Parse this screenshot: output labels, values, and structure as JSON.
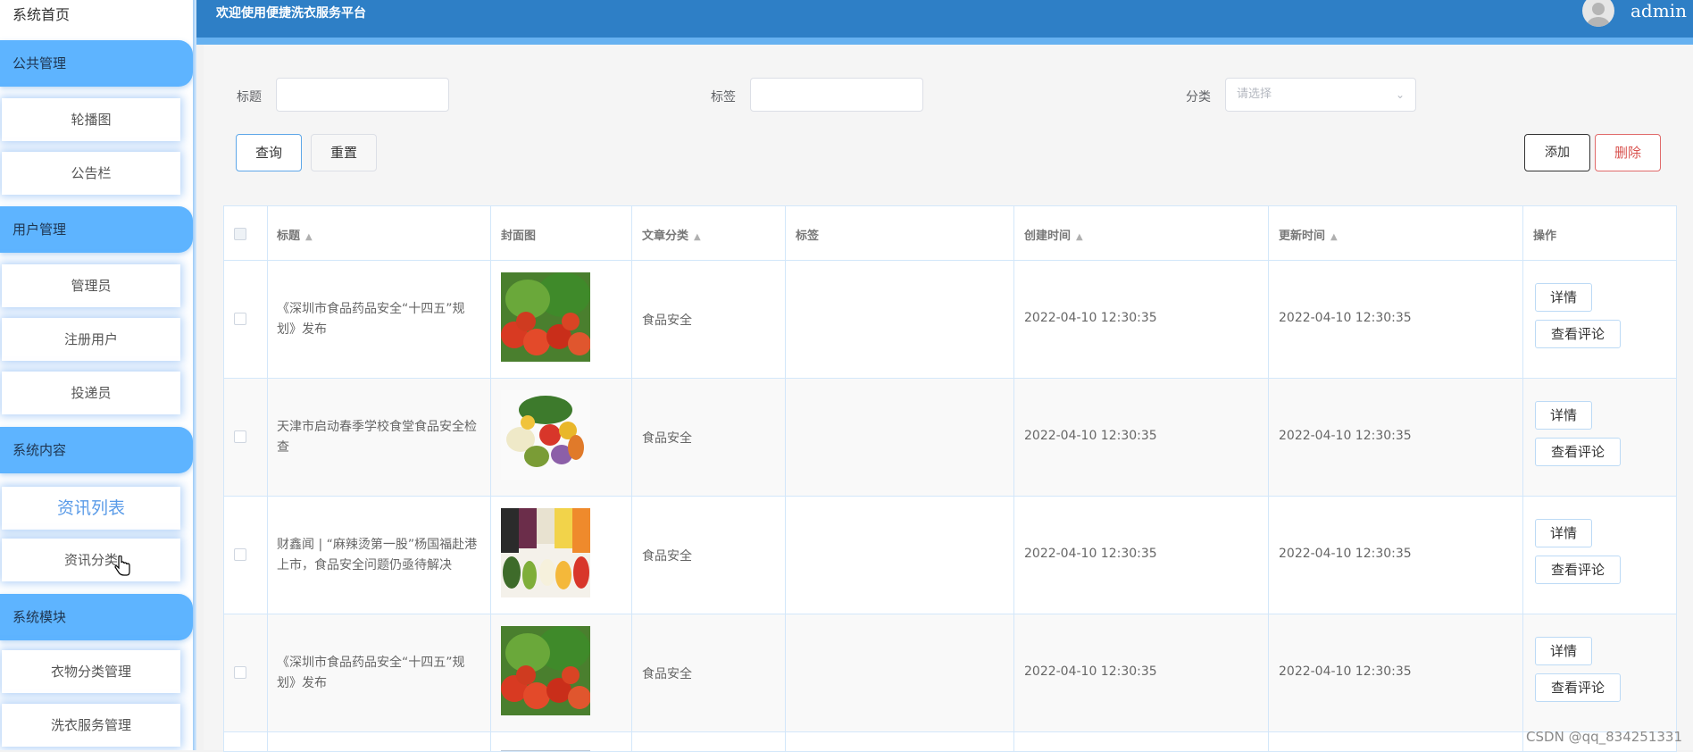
{
  "sidebar": {
    "home": "系统首页",
    "groups": [
      {
        "label": "公共管理",
        "items": [
          "轮播图",
          "公告栏"
        ]
      },
      {
        "label": "用户管理",
        "items": [
          "管理员",
          "注册用户",
          "投递员"
        ]
      },
      {
        "label": "系统内容",
        "items": [
          "资讯列表",
          "资讯分类"
        ]
      },
      {
        "label": "系统模块",
        "items": [
          "衣物分类管理",
          "洗衣服务管理"
        ]
      }
    ],
    "active_item": "资讯列表"
  },
  "header": {
    "welcome": "欢迎使用便捷洗衣服务平台",
    "username": "admin"
  },
  "filters": {
    "title_label": "标题",
    "tag_label": "标签",
    "category_label": "分类",
    "title_value": "",
    "tag_value": "",
    "category_placeholder": "请选择"
  },
  "buttons": {
    "query": "查询",
    "reset": "重置",
    "add": "添加",
    "delete": "删除"
  },
  "table": {
    "columns": [
      "标题",
      "封面图",
      "文章分类",
      "标签",
      "创建时间",
      "更新时间",
      "操作"
    ],
    "rows": [
      {
        "title": "《深圳市食品药品安全“十四五”规划》发布",
        "cover": "vegetables-image",
        "category": "食品安全",
        "tag": "",
        "created": "2022-04-10 12:30:35",
        "updated": "2022-04-10 12:30:35"
      },
      {
        "title": "天津市启动春季学校食堂食品安全检查",
        "cover": "vegetable-bundle-image",
        "category": "食品安全",
        "tag": "",
        "created": "2022-04-10 12:30:35",
        "updated": "2022-04-10 12:30:35"
      },
      {
        "title": "财鑫闻 | “麻辣烫第一股”杨国福赴港上市，食品安全问题仍亟待解决",
        "cover": "vegetable-grid-image",
        "category": "食品安全",
        "tag": "",
        "created": "2022-04-10 12:30:35",
        "updated": "2022-04-10 12:30:35"
      },
      {
        "title": "《深圳市食品药品安全“十四五”规划》发布",
        "cover": "vegetables-image",
        "category": "食品安全",
        "tag": "",
        "created": "2022-04-10 12:30:35",
        "updated": "2022-04-10 12:30:35"
      }
    ],
    "action_detail": "详情",
    "action_comments": "查看评论"
  },
  "watermark": "CSDN @qq_834251331",
  "colors": {
    "header": "#2e7fc6",
    "sidebar_group": "#5eb4ff",
    "active_item": "#5a9be8",
    "delete": "#d9534f"
  }
}
